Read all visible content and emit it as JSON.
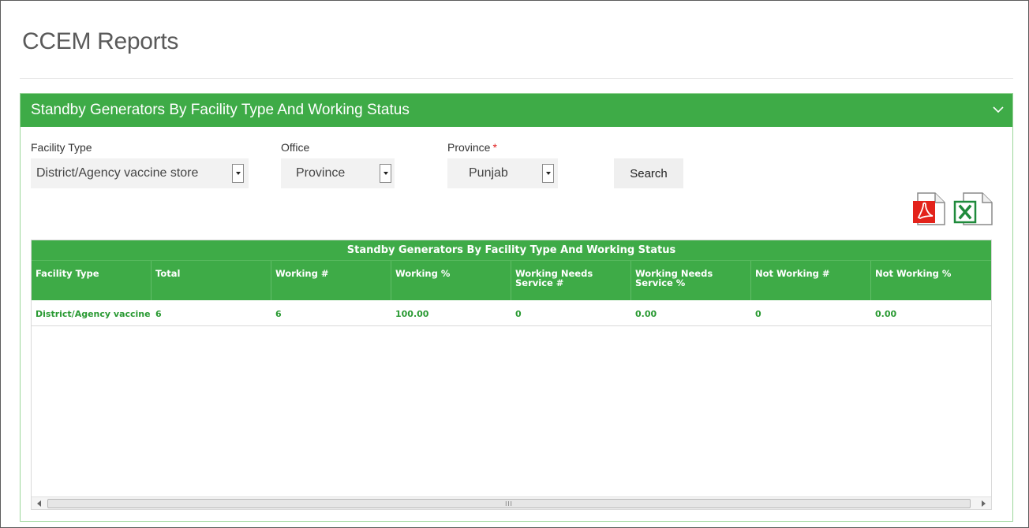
{
  "page": {
    "title": "CCEM Reports"
  },
  "panel": {
    "title": "Standby Generators By Facility Type And Working Status"
  },
  "filters": {
    "facility_type": {
      "label": "Facility Type",
      "value": "District/Agency vaccine store"
    },
    "office": {
      "label": "Office",
      "value": "Province"
    },
    "province": {
      "label": "Province",
      "required_mark": "*",
      "value": "Punjab"
    },
    "search_label": "Search"
  },
  "export": {
    "pdf_icon": "pdf-icon",
    "excel_icon": "excel-icon"
  },
  "table": {
    "caption": "Standby Generators By Facility Type And Working Status",
    "columns": [
      "Facility Type",
      "Total",
      "Working #",
      "Working %",
      "Working Needs Service #",
      "Working Needs Service %",
      "Not Working #",
      "Not Working %"
    ],
    "rows": [
      [
        "District/Agency vaccine store",
        "6",
        "6",
        "100.00",
        "0",
        "0.00",
        "0",
        "0.00"
      ]
    ],
    "scrollbar_grip": "III"
  },
  "colors": {
    "accent_green": "#3eab47",
    "cell_text_green": "#2a9a33",
    "pdf_red": "#e3231b",
    "excel_green": "#1f8a3b"
  }
}
